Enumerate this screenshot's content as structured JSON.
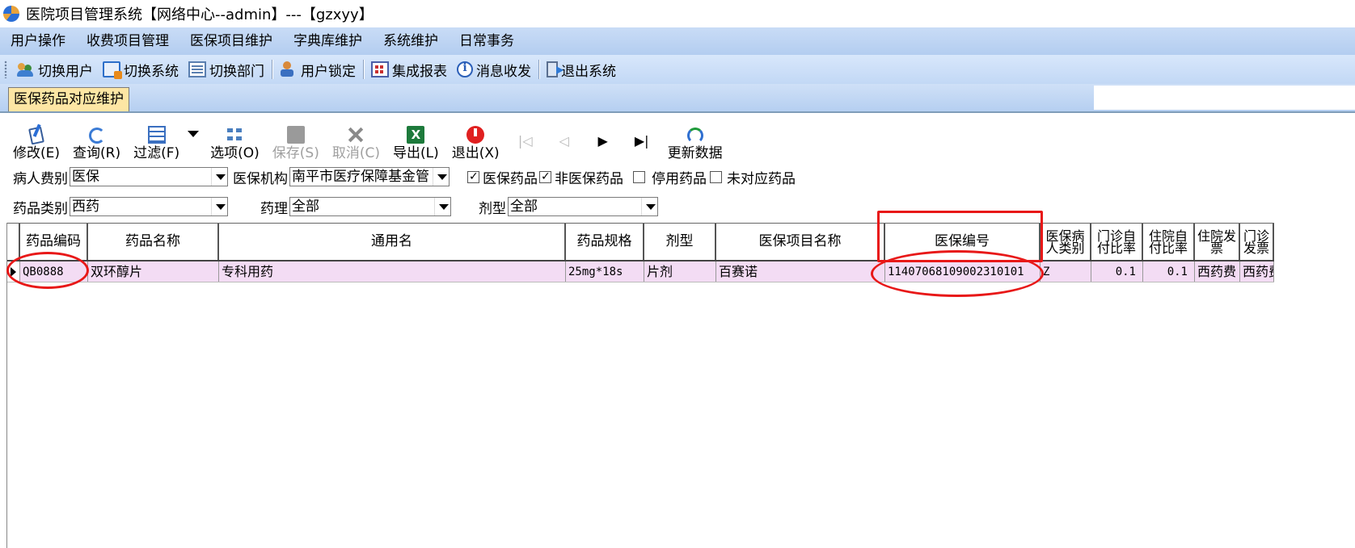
{
  "window": {
    "title": "医院项目管理系统【网络中心--admin】---【gzxyy】"
  },
  "menu": [
    "用户操作",
    "收费项目管理",
    "医保项目维护",
    "字典库维护",
    "系统维护",
    "日常事务"
  ],
  "toolbar": {
    "switch_user": "切换用户",
    "switch_system": "切换系统",
    "switch_dept": "切换部门",
    "user_lock": "用户锁定",
    "report": "集成报表",
    "message": "消息收发",
    "exit_system": "退出系统"
  },
  "tab": {
    "active": "医保药品对应维护"
  },
  "inner_toolbar": {
    "edit": "修改(E)",
    "query": "查询(R)",
    "filter": "过滤(F)",
    "options": "选项(O)",
    "save": "保存(S)",
    "cancel": "取消(C)",
    "export": "导出(L)",
    "quit": "退出(X)",
    "refresh": "更新数据",
    "nav_first": "|◁",
    "nav_prev": "◁",
    "nav_next": "▶",
    "nav_last": "▶|"
  },
  "filters": {
    "patient_type_label": "病人费别",
    "patient_type_value": "医保",
    "insurer_label": "医保机构",
    "insurer_value": "南平市医疗保障基金管",
    "chk_insured": "医保药品",
    "chk_non_insured": "非医保药品",
    "chk_disabled": "停用药品",
    "chk_unmatched": "未对应药品",
    "drug_class_label": "药品类别",
    "drug_class_value": "西药",
    "pharm_label": "药理",
    "pharm_value": "全部",
    "form_label": "剂型",
    "form_value": "全部"
  },
  "grid": {
    "headers": [
      "药品编码",
      "药品名称",
      "通用名",
      "药品规格",
      "剂型",
      "医保项目名称",
      "医保编号",
      "医保病人类别",
      "门诊自付比率",
      "住院自付比率",
      "住院发票",
      "门诊发票"
    ],
    "row": {
      "code": "QB0888",
      "name": "双环醇片",
      "generic": "专科用药",
      "spec": "25mg*18s",
      "form": "片剂",
      "insure_name": "百赛诺",
      "insure_code": "11407068109002310101",
      "patient_class": "Z",
      "opd_ratio": "0.1",
      "ipd_ratio": "0.1",
      "ipd_invoice": "西药费",
      "opd_invoice": "西药费"
    }
  },
  "colors": {
    "accent": "#b3cdf0",
    "tab_active": "#fde6a4",
    "row_highlight": "#f3dcf4",
    "annotation": "#e81818"
  }
}
